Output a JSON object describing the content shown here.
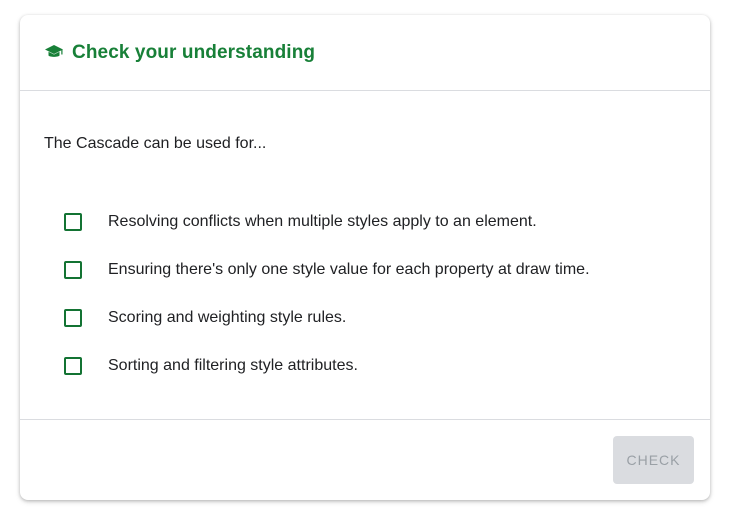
{
  "card": {
    "title": "Check your understanding",
    "title_icon": "graduation-cap-icon",
    "accent_color": "#188038"
  },
  "question": "The Cascade can be used for...",
  "options": [
    {
      "label": "Resolving conflicts when multiple styles apply to an element.",
      "checked": false
    },
    {
      "label": "Ensuring there's only one style value for each property at draw time.",
      "checked": false
    },
    {
      "label": "Scoring and weighting style rules.",
      "checked": false
    },
    {
      "label": "Sorting and filtering style attributes.",
      "checked": false
    }
  ],
  "footer": {
    "check_label": "Check",
    "check_disabled": true
  }
}
